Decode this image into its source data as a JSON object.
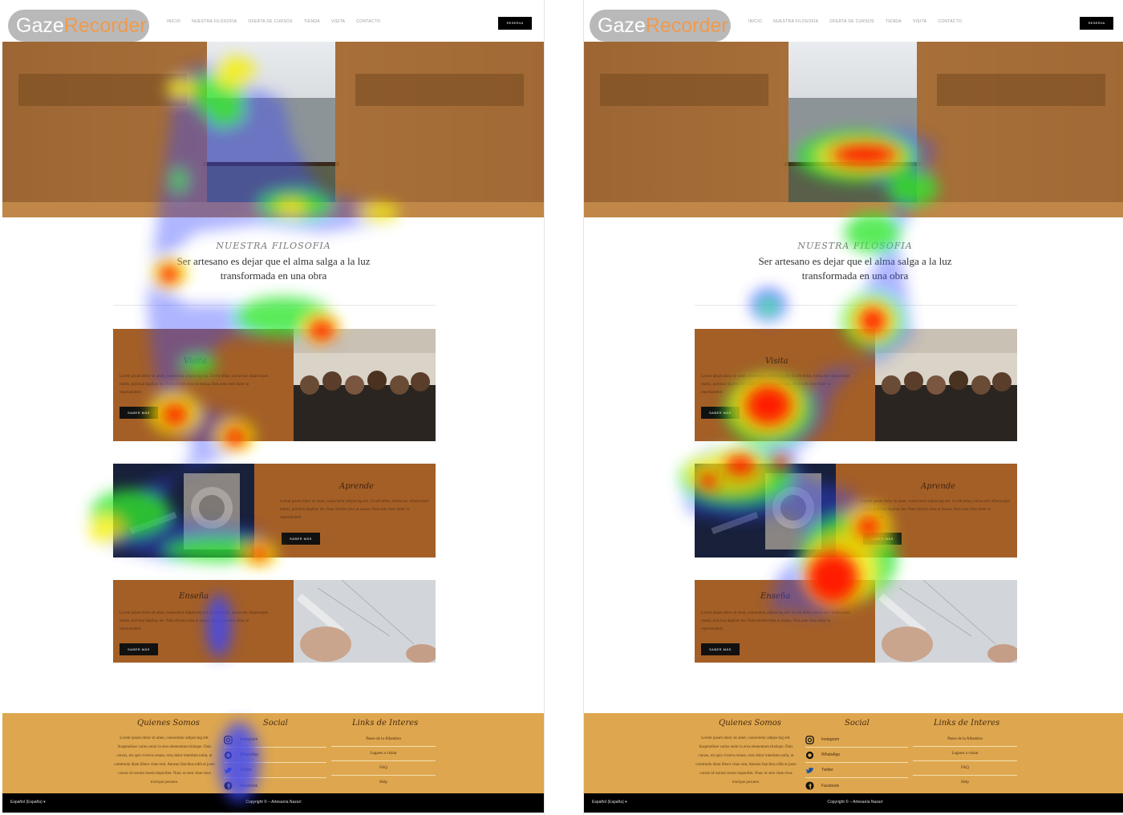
{
  "badge": {
    "part1": "Gaze",
    "part2": "Recorder"
  },
  "nav": {
    "links": [
      "INICIO",
      "NUESTRA FILOSOFÍA",
      "OFERTA DE CURSOS",
      "TIENDA",
      "VISITA",
      "CONTACTO"
    ],
    "button": "RESERVA"
  },
  "philosophy": {
    "eyebrow": "NUESTRA FILOSOFIA",
    "quote": "Ser artesano es dejar que el alma salga a la luz transformada en una obra"
  },
  "cards": [
    {
      "title": "Visita",
      "body": "Lorem ipsum dolor sit amet, consectetur adipiscing elit. Ut elit tellus, luctus nec ullamcorper mattis, pulvinar dapibus leo. Nam dictum risus at massa. Duis aute irure dolor in reprehenderit.",
      "button": "SABER MÁS"
    },
    {
      "title": "Aprende",
      "body": "Lorem ipsum dolor sit amet, consectetur adipiscing elit. Ut elit tellus, luctus nec ullamcorper mattis, pulvinar dapibus leo. Nam dictum risus at massa. Duis aute irure dolor in reprehenderit.",
      "button": "SABER MÁS"
    },
    {
      "title": "Enseña",
      "body": "Lorem ipsum dolor sit amet, consectetur adipiscing elit. Ut elit tellus, luctus nec ullamcorper mattis, pulvinar dapibus leo. Nam dictum risus at massa. Duis aute irure dolor in reprehenderit.",
      "button": "SABER MÁS"
    }
  ],
  "footer": {
    "about_title": "Quienes Somos",
    "about_text": "Lorem ipsum dolor sit amet, consectetur adipiscing elit. Suspendisse varius enim in eros elementum tristique. Duis cursus, mi quis viverra ornare, eros dolor interdum nulla, ut commodo diam libero vitae erat. Aenean faucibus nibh et justo cursus id rutrum lorem imperdiet. Nunc ut sem vitae risus tristique posuere.",
    "social_title": "Social",
    "social": [
      {
        "label": "Instagram",
        "icon": "instagram-icon"
      },
      {
        "label": "WhatsApp",
        "icon": "whatsapp-icon"
      },
      {
        "label": "Twitter",
        "icon": "twitter-icon"
      },
      {
        "label": "Facebook",
        "icon": "facebook-icon"
      }
    ],
    "links_title": "Links de Interes",
    "links": [
      "Paseo de la Alhambra",
      "Lugares a visitar",
      "FAQ",
      "Help"
    ]
  },
  "bottom": {
    "language": "Español (España) ▾",
    "copyright": "Copyright © – Artesanía Nazarí"
  },
  "colors": {
    "card_brown": "#a45f27",
    "footer_gold": "#dea74f",
    "heat_red": "#ff1a00",
    "heat_yellow": "#f4f000",
    "heat_green": "#33e633",
    "heat_blue": "#3a46ff"
  }
}
